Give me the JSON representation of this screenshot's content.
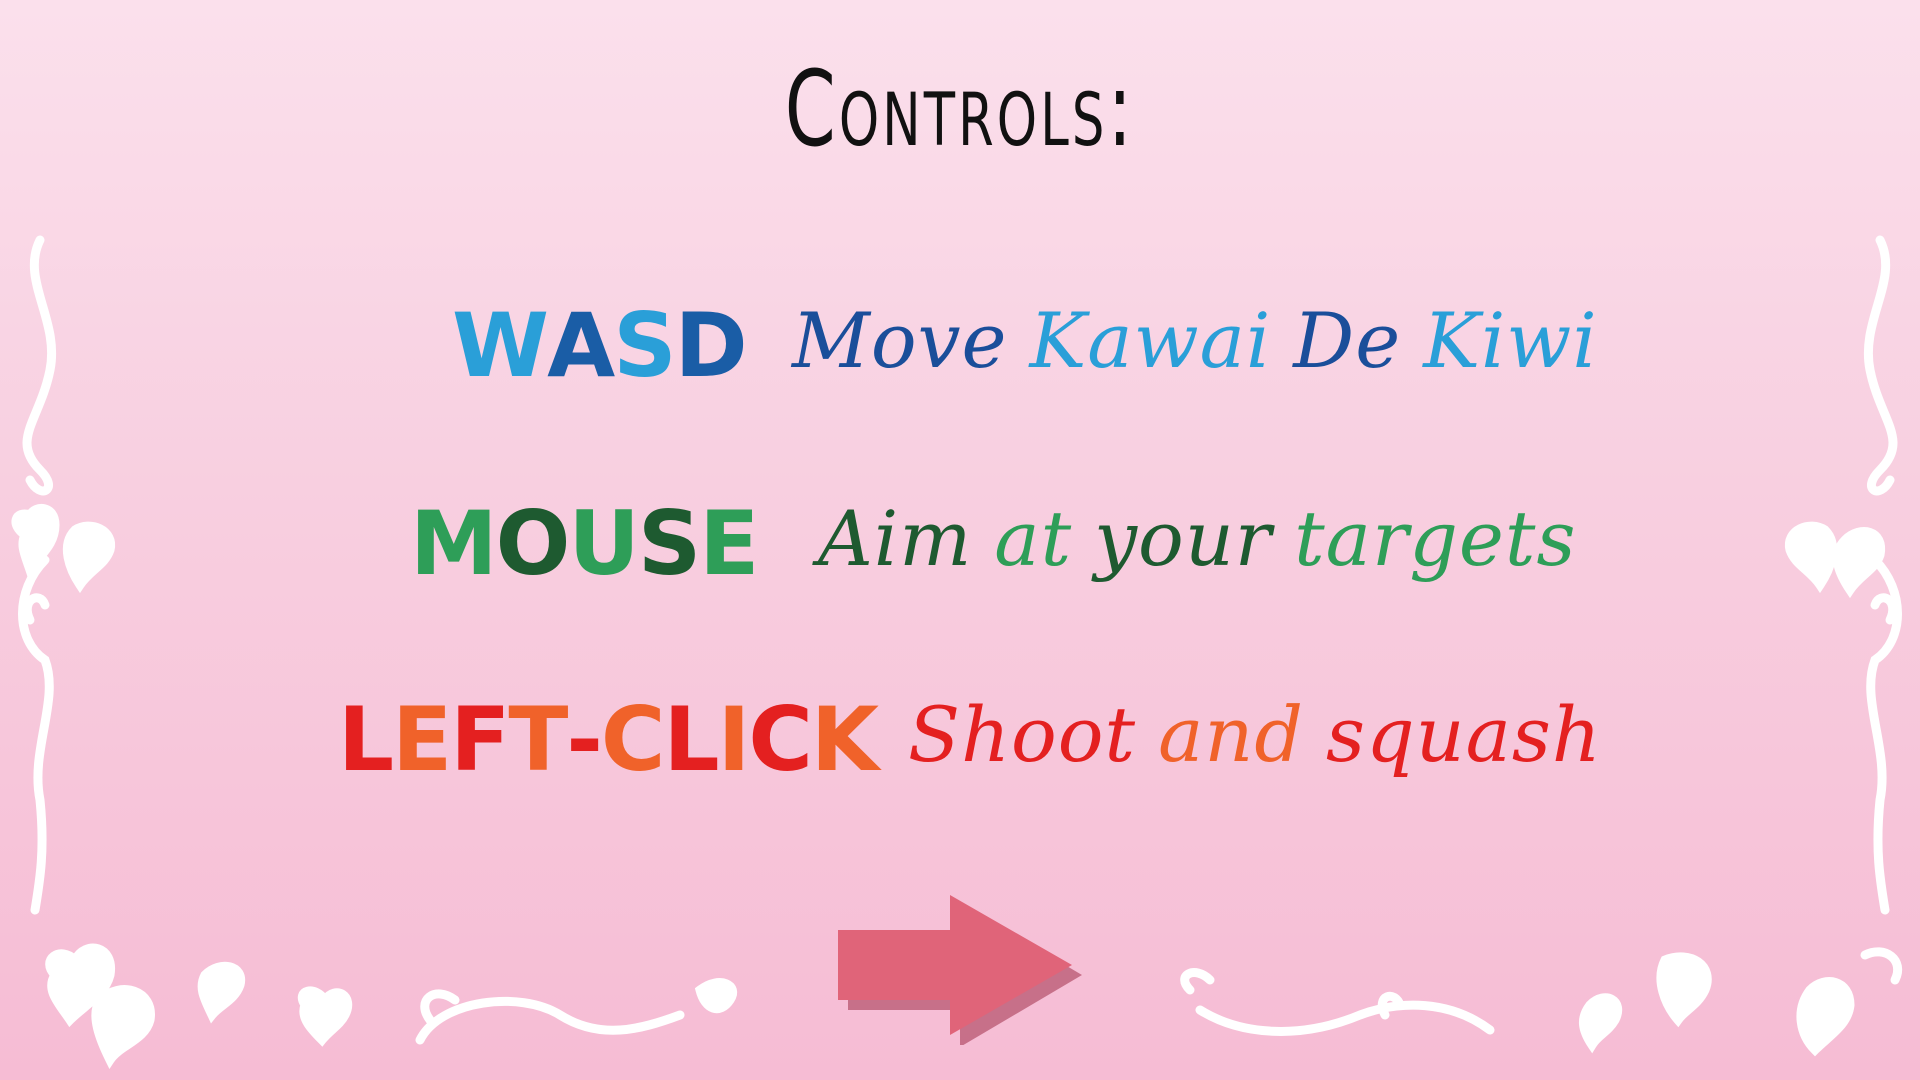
{
  "title": "Controls:",
  "controls": [
    {
      "key": [
        {
          "text": "W",
          "color": "#2a9fd8"
        },
        {
          "text": "A",
          "color": "#1a5da6"
        },
        {
          "text": "S",
          "color": "#2a9fd8"
        },
        {
          "text": "D",
          "color": "#1a5da6"
        }
      ],
      "desc": [
        {
          "text": "Move",
          "color": "#1a4e9a"
        },
        {
          "text": "Kawai",
          "color": "#2a9fd8"
        },
        {
          "text": "De",
          "color": "#1a4e9a"
        },
        {
          "text": "Kiwi",
          "color": "#2a9fd8"
        }
      ]
    },
    {
      "key": [
        {
          "text": "M",
          "color": "#2e9e58"
        },
        {
          "text": "O",
          "color": "#1e5a30"
        },
        {
          "text": "U",
          "color": "#2e9e58"
        },
        {
          "text": "S",
          "color": "#1e5a30"
        },
        {
          "text": "E",
          "color": "#2e9e58"
        }
      ],
      "desc": [
        {
          "text": "Aim",
          "color": "#1e5a30"
        },
        {
          "text": "at",
          "color": "#2e9e58"
        },
        {
          "text": "your",
          "color": "#1e5a30"
        },
        {
          "text": "targets",
          "color": "#2e9e58"
        }
      ]
    },
    {
      "key": [
        {
          "text": "L",
          "color": "#e42020"
        },
        {
          "text": "E",
          "color": "#f0622a"
        },
        {
          "text": "F",
          "color": "#e42020"
        },
        {
          "text": "T",
          "color": "#f0622a"
        },
        {
          "text": "-",
          "color": "#e42020"
        },
        {
          "text": "C",
          "color": "#f0622a"
        },
        {
          "text": "L",
          "color": "#e42020"
        },
        {
          "text": "I",
          "color": "#f0622a"
        },
        {
          "text": "C",
          "color": "#e42020"
        },
        {
          "text": "K",
          "color": "#f0622a"
        }
      ],
      "desc": [
        {
          "text": "Shoot",
          "color": "#e42020"
        },
        {
          "text": "and",
          "color": "#f0622a"
        },
        {
          "text": "squash",
          "color": "#e42020"
        }
      ]
    }
  ],
  "next_button": {
    "icon": "right-arrow-icon",
    "color": "#e06479"
  },
  "colors": {
    "frame": "#ffffff",
    "background_top": "#fbe0ec",
    "background_bottom": "#f6bcd4"
  }
}
